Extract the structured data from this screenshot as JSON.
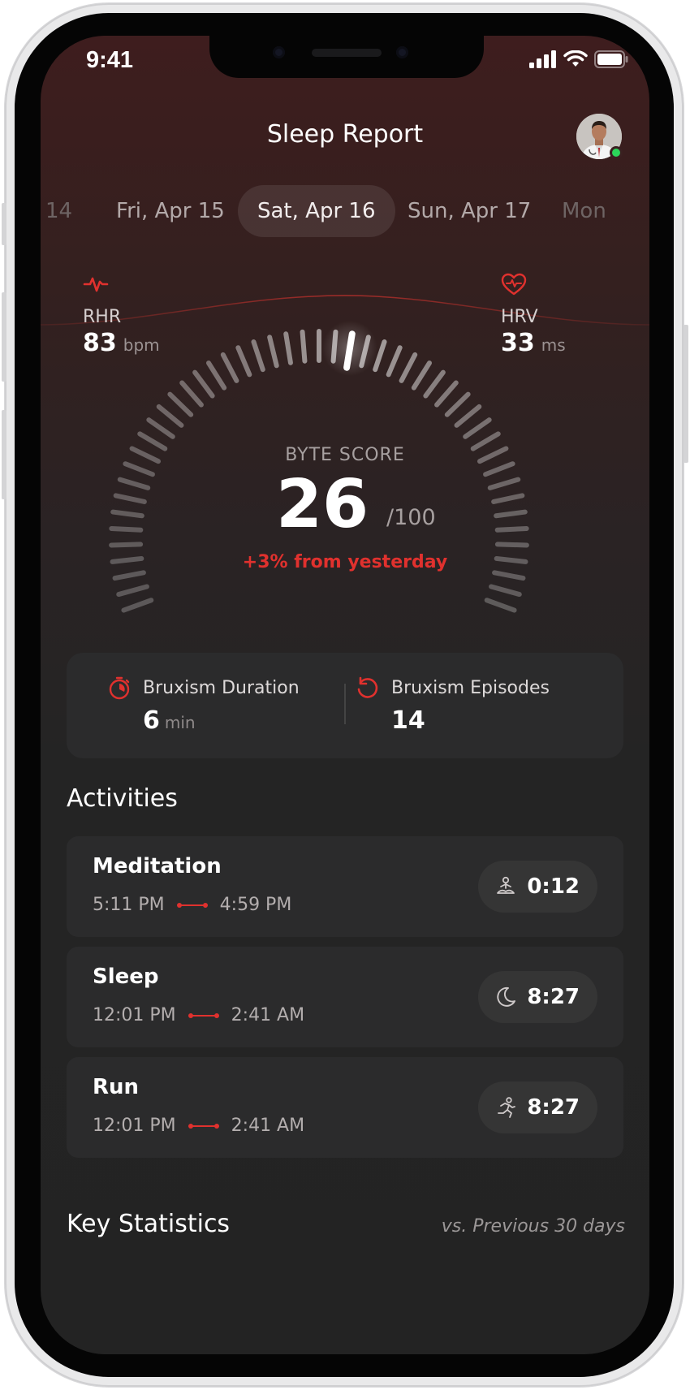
{
  "status": {
    "time": "9:41"
  },
  "header": {
    "title": "Sleep Report"
  },
  "dates": [
    {
      "label": "14",
      "active": false
    },
    {
      "label": "Fri, Apr 15",
      "active": false
    },
    {
      "label": "Sat, Apr 16",
      "active": true
    },
    {
      "label": "Sun, Apr 17",
      "active": false
    },
    {
      "label": "Mon",
      "active": false
    }
  ],
  "rhr": {
    "label": "RHR",
    "value": "83",
    "unit": "bpm"
  },
  "hrv": {
    "label": "HRV",
    "value": "33",
    "unit": "ms"
  },
  "score": {
    "label": "BYTE SCORE",
    "value": "26",
    "max": "/100",
    "delta": "+3% from yesterday",
    "fraction": 0.26
  },
  "bruxism": {
    "duration": {
      "title": "Bruxism Duration",
      "value": "6",
      "unit": "min"
    },
    "episodes": {
      "title": "Bruxism Episodes",
      "value": "14"
    }
  },
  "activities": {
    "title": "Activities",
    "items": [
      {
        "name": "Meditation",
        "start": "5:11 PM",
        "end": "4:59 PM",
        "duration": "0:12",
        "icon": "meditation-icon"
      },
      {
        "name": "Sleep",
        "start": "12:01 PM",
        "end": "2:41 AM",
        "duration": "8:27",
        "icon": "moon-icon"
      },
      {
        "name": "Run",
        "start": "12:01 PM",
        "end": "2:41 AM",
        "duration": "8:27",
        "icon": "run-icon"
      }
    ]
  },
  "key_statistics": {
    "title": "Key Statistics",
    "comparison": "vs. Previous 30 days"
  },
  "colors": {
    "accent": "#e0312e",
    "online": "#2bd65a",
    "card": "#2b2b2c"
  }
}
